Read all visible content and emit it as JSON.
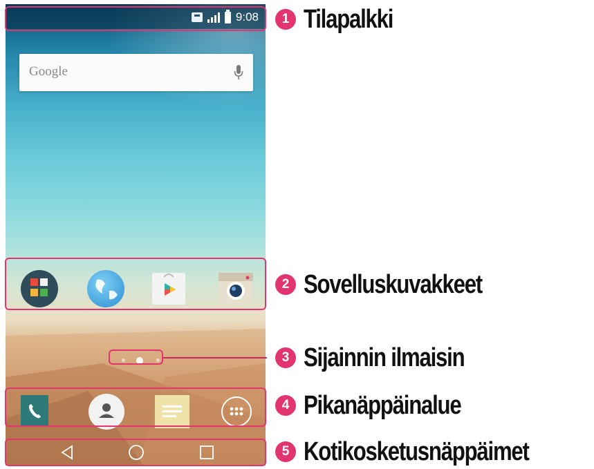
{
  "status_bar": {
    "time": "9:08",
    "icons": [
      "sim-icon",
      "signal-icon",
      "battery-icon"
    ]
  },
  "search_widget": {
    "label": "Google",
    "icon": "mic-icon"
  },
  "app_icons": [
    "apps-folder-icon",
    "browser-globe-icon",
    "play-store-icon",
    "camera-icon"
  ],
  "page_indicator": {
    "pages": 3,
    "active_page": 2
  },
  "quick_keys": [
    "phone-icon",
    "contacts-icon",
    "messages-icon",
    "app-drawer-icon"
  ],
  "navigation_keys": [
    "back-icon",
    "home-icon",
    "recent-apps-icon"
  ],
  "callouts": [
    {
      "number": "1",
      "label": "Tilapalkki"
    },
    {
      "number": "2",
      "label": "Sovelluskuvakkeet"
    },
    {
      "number": "3",
      "label": "Sijainnin ilmaisin"
    },
    {
      "number": "4",
      "label": "Pikanäppäinalue"
    },
    {
      "number": "5",
      "label": "Kotikosketusnäppäimet"
    }
  ],
  "colors": {
    "callout_accent": "#e2356f",
    "label_text": "#111111"
  }
}
